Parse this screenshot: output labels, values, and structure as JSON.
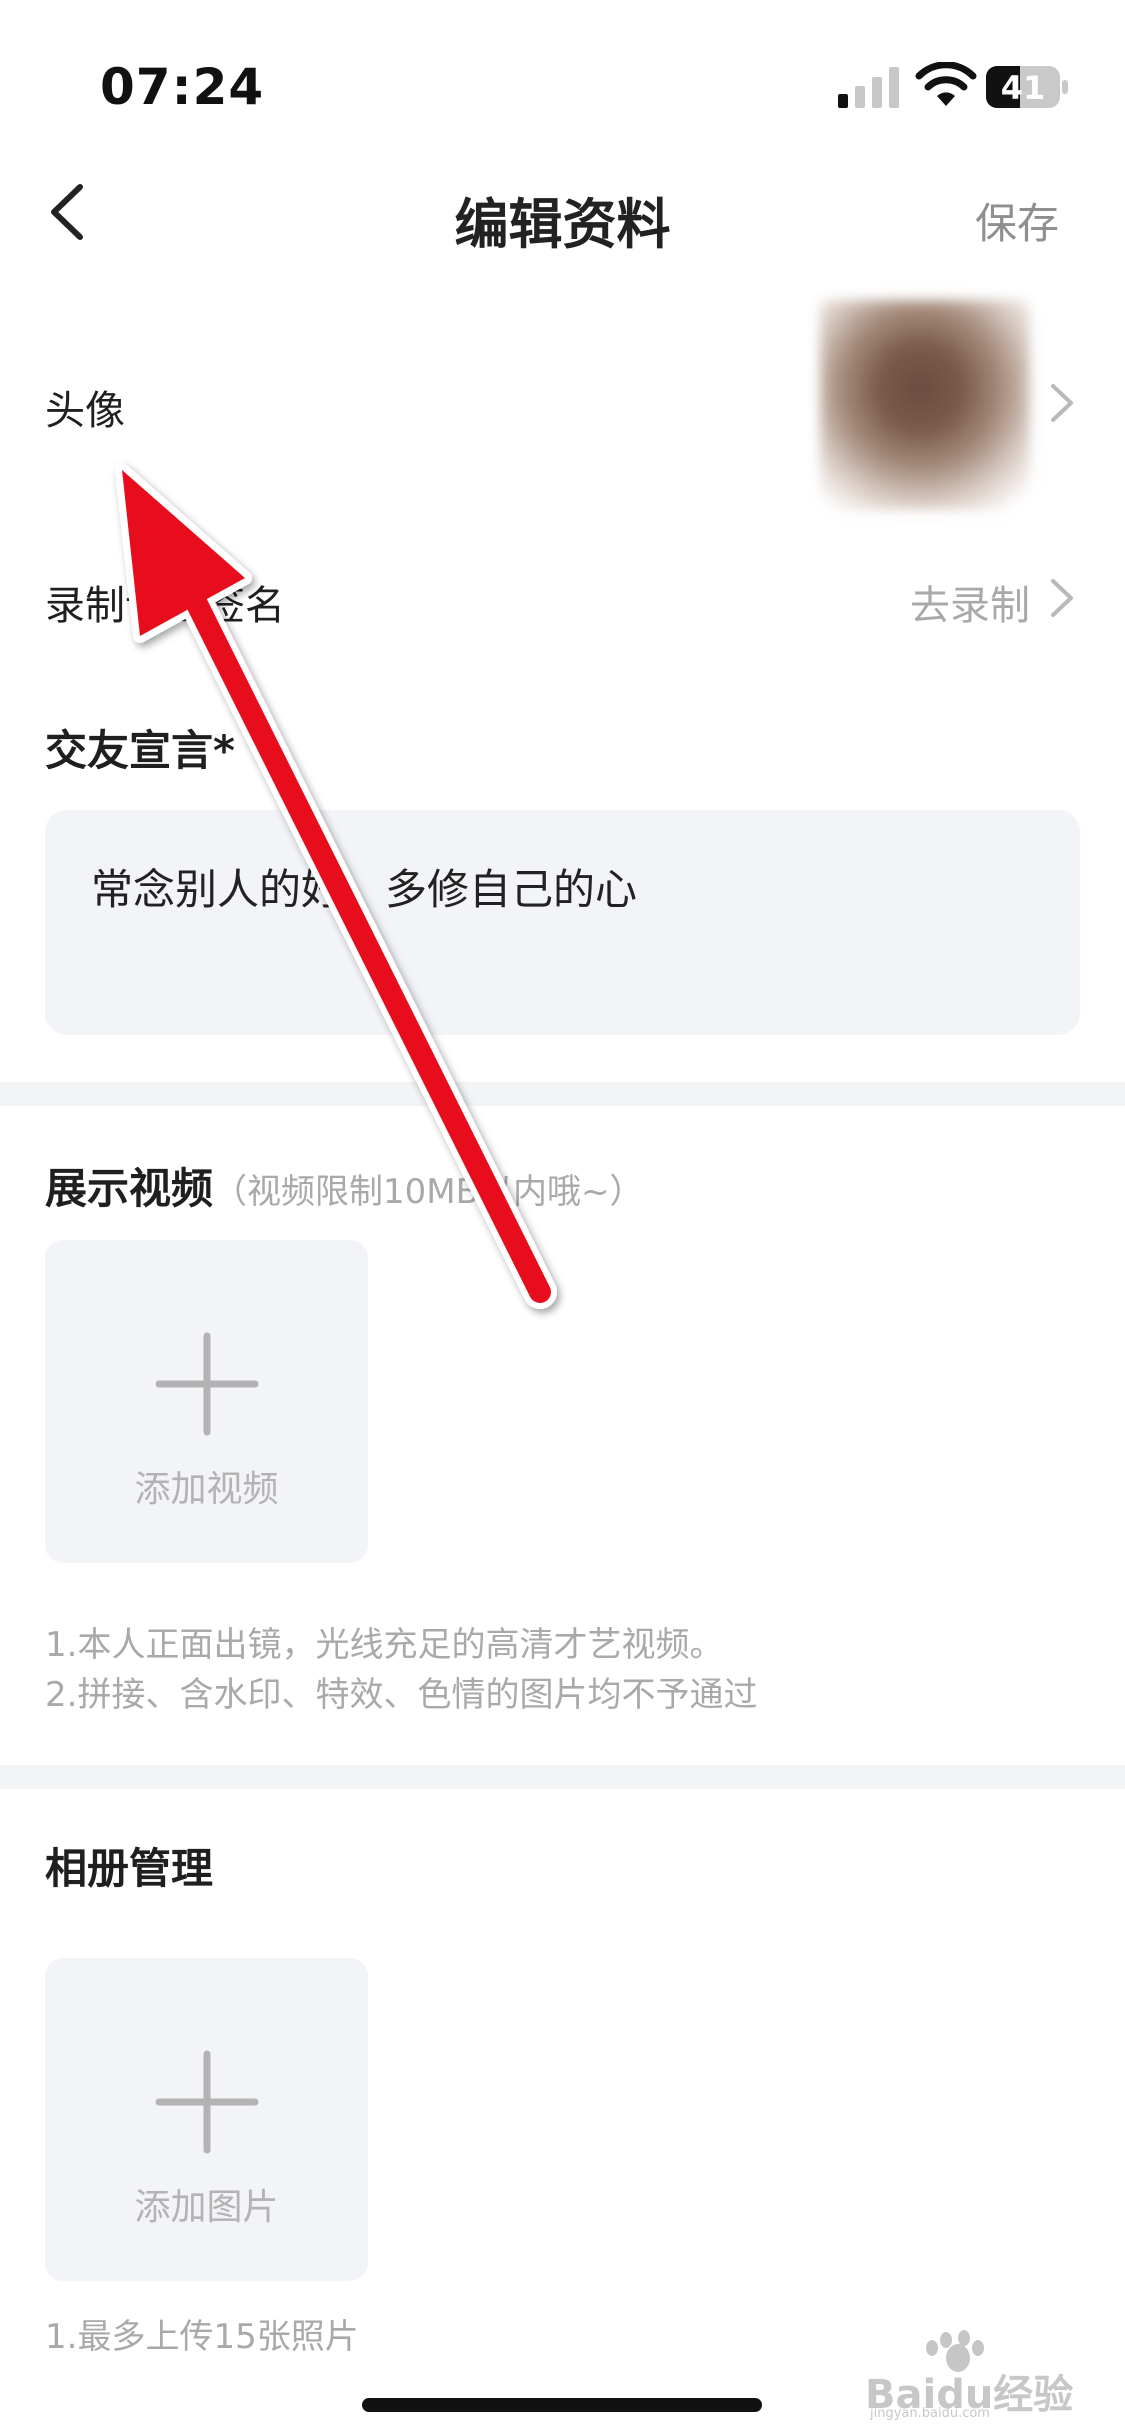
{
  "status_bar": {
    "time": "07:24",
    "battery": "41"
  },
  "nav": {
    "title": "编辑资料",
    "save_label": "保存"
  },
  "rows": {
    "avatar_label": "头像",
    "voice_sign_label": "录制语音签名",
    "voice_sign_value": "去录制"
  },
  "declaration": {
    "label": "交友宣言*",
    "text": "常念别人的好，多修自己的心"
  },
  "video_section": {
    "title": "展示视频",
    "hint": "（视频限制10MB以内哦~）",
    "add_label": "添加视频",
    "rules": [
      "1.本人正面出镜，光线充足的高清才艺视频。",
      "2.拼接、含水印、特效、色情的图片均不予通过"
    ]
  },
  "album_section": {
    "title": "相册管理",
    "add_label": "添加图片",
    "rules": [
      "1.最多上传15张照片"
    ]
  },
  "watermark": {
    "text": "Baidu经验",
    "subtext": "jingyan.baidu.com"
  },
  "colors": {
    "arrow": "#e8101e",
    "box_bg": "#f2f4f7",
    "muted_text": "#a9a9a9"
  }
}
